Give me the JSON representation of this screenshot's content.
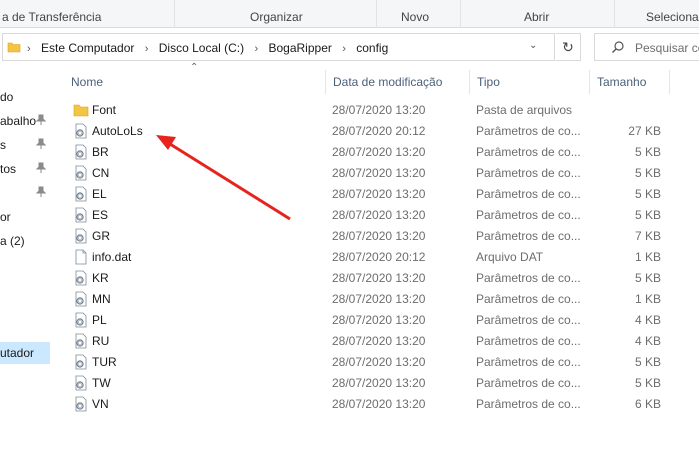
{
  "ribbon": {
    "groups": [
      {
        "label": "a de Transferência"
      },
      {
        "label": "Organizar"
      },
      {
        "label": "Novo"
      },
      {
        "label": "Abrir"
      },
      {
        "label": "Selecionar"
      }
    ]
  },
  "address": {
    "crumbs": [
      "Este Computador",
      "Disco Local (C:)",
      "BogaRipper",
      "config"
    ],
    "search_placeholder": "Pesquisar co"
  },
  "nav": {
    "items": [
      {
        "label": "do",
        "pinned": false
      },
      {
        "label": "abalho",
        "pinned": true
      },
      {
        "label": "s",
        "pinned": true
      },
      {
        "label": "tos",
        "pinned": true
      },
      {
        "label": "",
        "pinned": true
      },
      {
        "label": "or",
        "pinned": false
      },
      {
        "label": "a (2)",
        "pinned": false
      },
      {
        "label": "utador",
        "pinned": false,
        "selected": true
      }
    ]
  },
  "columns": {
    "name": "Nome",
    "date": "Data de modificação",
    "type": "Tipo",
    "size": "Tamanho"
  },
  "files": [
    {
      "name": "Font",
      "date": "28/07/2020 13:20",
      "type": "Pasta de arquivos",
      "size": "",
      "icon": "folder-icon"
    },
    {
      "name": "AutoLoLs",
      "date": "28/07/2020 20:12",
      "type": "Parâmetros de co...",
      "size": "27 KB",
      "icon": "config-file-icon"
    },
    {
      "name": "BR",
      "date": "28/07/2020 13:20",
      "type": "Parâmetros de co...",
      "size": "5 KB",
      "icon": "config-file-icon"
    },
    {
      "name": "CN",
      "date": "28/07/2020 13:20",
      "type": "Parâmetros de co...",
      "size": "5 KB",
      "icon": "config-file-icon"
    },
    {
      "name": "EL",
      "date": "28/07/2020 13:20",
      "type": "Parâmetros de co...",
      "size": "5 KB",
      "icon": "config-file-icon"
    },
    {
      "name": "ES",
      "date": "28/07/2020 13:20",
      "type": "Parâmetros de co...",
      "size": "5 KB",
      "icon": "config-file-icon"
    },
    {
      "name": "GR",
      "date": "28/07/2020 13:20",
      "type": "Parâmetros de co...",
      "size": "7 KB",
      "icon": "config-file-icon"
    },
    {
      "name": "info.dat",
      "date": "28/07/2020 20:12",
      "type": "Arquivo DAT",
      "size": "1 KB",
      "icon": "generic-file-icon"
    },
    {
      "name": "KR",
      "date": "28/07/2020 13:20",
      "type": "Parâmetros de co...",
      "size": "5 KB",
      "icon": "config-file-icon"
    },
    {
      "name": "MN",
      "date": "28/07/2020 13:20",
      "type": "Parâmetros de co...",
      "size": "1 KB",
      "icon": "config-file-icon"
    },
    {
      "name": "PL",
      "date": "28/07/2020 13:20",
      "type": "Parâmetros de co...",
      "size": "4 KB",
      "icon": "config-file-icon"
    },
    {
      "name": "RU",
      "date": "28/07/2020 13:20",
      "type": "Parâmetros de co...",
      "size": "4 KB",
      "icon": "config-file-icon"
    },
    {
      "name": "TUR",
      "date": "28/07/2020 13:20",
      "type": "Parâmetros de co...",
      "size": "5 KB",
      "icon": "config-file-icon"
    },
    {
      "name": "TW",
      "date": "28/07/2020 13:20",
      "type": "Parâmetros de co...",
      "size": "5 KB",
      "icon": "config-file-icon"
    },
    {
      "name": "VN",
      "date": "28/07/2020 13:20",
      "type": "Parâmetros de co...",
      "size": "6 KB",
      "icon": "config-file-icon"
    }
  ],
  "annotation": {
    "color": "#e8231d",
    "points_to": "AutoLoLs"
  },
  "colors": {
    "selection": "#cce8ff",
    "folder": "#f4c542",
    "header_text": "#4c607a"
  }
}
